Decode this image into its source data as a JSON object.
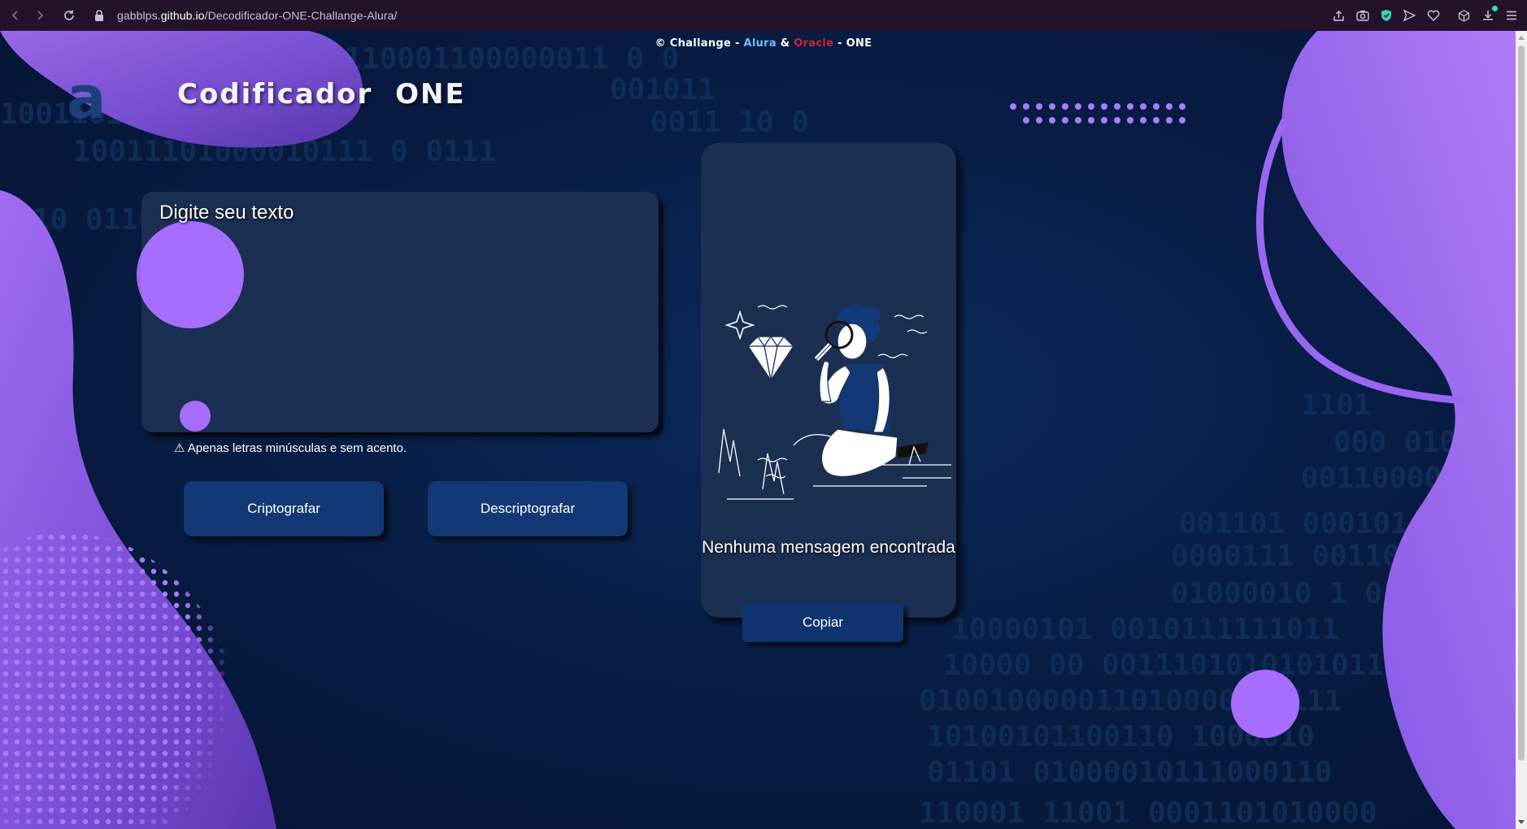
{
  "browser": {
    "url_prefix": "gabblps.",
    "url_host": "github.io",
    "url_path": "/Decodificador-ONE-Challange-Alura/"
  },
  "credit": {
    "prefix": "© Challange - ",
    "alura": "Alura",
    "amp": " & ",
    "oracle": "Oracle",
    "suffix": " - ONE"
  },
  "brand_mark": "a",
  "title": "Codificador ONE",
  "input": {
    "placeholder": "Digite seu texto",
    "value": ""
  },
  "warning": "⚠ Apenas letras minúsculas e sem acento.",
  "buttons": {
    "encrypt": "Criptografar",
    "decrypt": "Descriptografar",
    "copy": "Copiar"
  },
  "output": {
    "message": "Nenhuma mensagem encontrada"
  },
  "binary_lines": [
    "10110001100000011  0  0",
    "001011",
    "1001101  0011  1000",
    "0011  10  0",
    "10011101000010111  0  0111",
    "1101",
    "10  0110",
    "000  01010",
    "00110000",
    "001101  000101",
    "0000111  0011010",
    "01000010  1  01",
    "10000101  0010111111011",
    "10000  00  0011101010101011",
    "0100100000110100001  1111",
    "10100101100110  1000010",
    "01101  01000010111000110",
    "110001  11001  0001101010000"
  ],
  "colors": {
    "accent_purple": "#a366ff",
    "background_navy": "#0a1a3d",
    "card": "#1b2f52",
    "button": "#123975",
    "alura": "#6cc0ff",
    "oracle": "#c8282f"
  }
}
